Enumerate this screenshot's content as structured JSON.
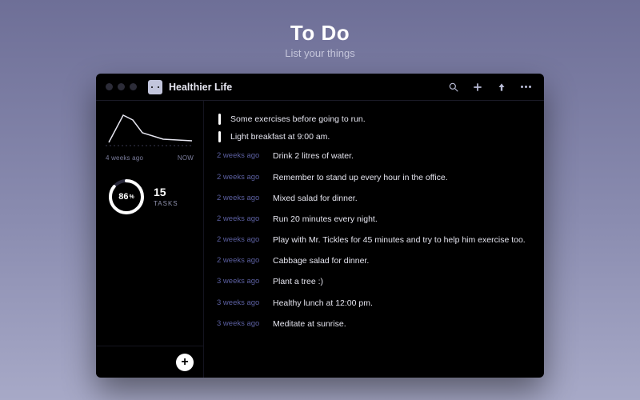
{
  "hero": {
    "title": "To Do",
    "subtitle": "List your things"
  },
  "window": {
    "title": "Healthier Life"
  },
  "sidebar": {
    "range_start": "4 weeks ago",
    "range_end": "NOW",
    "progress_pct": 86,
    "progress_label": "86",
    "progress_suffix": "%",
    "task_count": "15",
    "task_label": "TASKS"
  },
  "tasks": [
    {
      "age": "",
      "text": "Some exercises before going to run.",
      "highlight": true
    },
    {
      "age": "",
      "text": "Light breakfast at 9:00 am.",
      "highlight": true
    },
    {
      "age": "2 weeks ago",
      "text": "Drink 2 litres of water.",
      "highlight": false
    },
    {
      "age": "2 weeks ago",
      "text": "Remember to stand up every hour in the office.",
      "highlight": false
    },
    {
      "age": "2 weeks ago",
      "text": "Mixed salad for dinner.",
      "highlight": false
    },
    {
      "age": "2 weeks ago",
      "text": "Run 20 minutes every night.",
      "highlight": false
    },
    {
      "age": "2 weeks ago",
      "text": "Play with Mr. Tickles for 45 minutes and try to help him exercise too.",
      "highlight": false
    },
    {
      "age": "2 weeks ago",
      "text": "Cabbage salad for dinner.",
      "highlight": false
    },
    {
      "age": "3 weeks ago",
      "text": "Plant a tree :)",
      "highlight": false
    },
    {
      "age": "3 weeks ago",
      "text": "Healthy lunch at 12:00 pm.",
      "highlight": false
    },
    {
      "age": "3 weeks ago",
      "text": "Meditate at sunrise.",
      "highlight": false
    }
  ]
}
